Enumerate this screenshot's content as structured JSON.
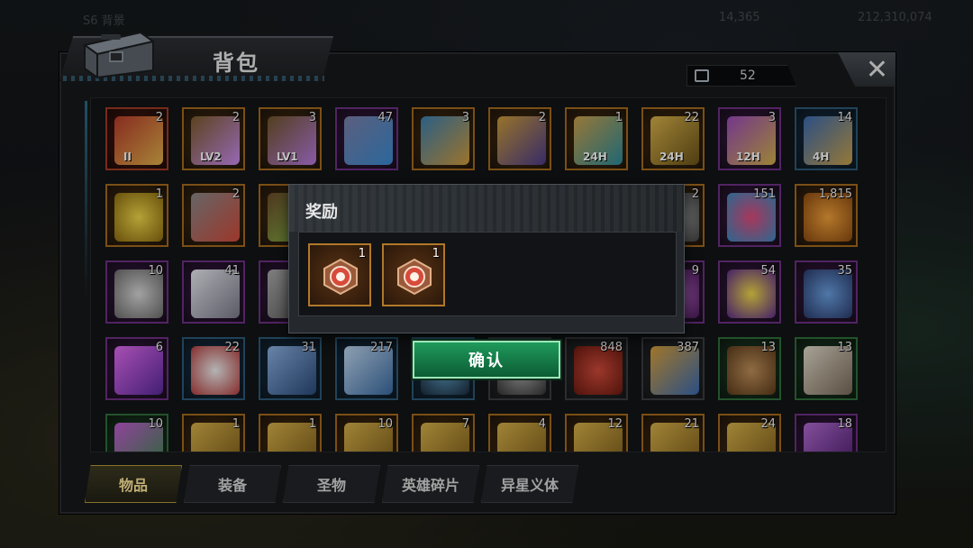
{
  "background_hud": {
    "left_text": "S6 背景",
    "mid_value": "14,365",
    "right_value": "212,310,074"
  },
  "panel": {
    "title": "背包",
    "item_count": "52",
    "close_label": "✕"
  },
  "colors": {
    "orange": "#a56a1c",
    "purple": "#6e2f85",
    "blue": "#2c5877",
    "green": "#2f6e3a",
    "confirm": "#1f9a5c",
    "tab_active": "#b59a3a"
  },
  "grid": {
    "rows": [
      [
        {
          "name": "supply-crate-ii-icon",
          "qty": "2",
          "rarity": "r-red",
          "tag": "II",
          "art": "linear-gradient(135deg,#b53a2a,#e0b04a)"
        },
        {
          "name": "supply-crate-lv2-icon",
          "qty": "2",
          "rarity": "r-orange",
          "tag": "LV2",
          "art": "linear-gradient(135deg,#7a5a28,#c98cf0)"
        },
        {
          "name": "supply-crate-lv1-icon",
          "qty": "3",
          "rarity": "r-orange",
          "tag": "LV1",
          "art": "linear-gradient(135deg,#6e5428,#b67ae0)"
        },
        {
          "name": "gadget-icon",
          "qty": "47",
          "rarity": "r-purple",
          "tag": "",
          "art": "linear-gradient(135deg,#7a7fa8,#3a8ad0)"
        },
        {
          "name": "blue-crate-icon",
          "qty": "3",
          "rarity": "r-orange",
          "tag": "",
          "art": "linear-gradient(135deg,#3a7fb0,#d09a3a)"
        },
        {
          "name": "gold-crate-icon",
          "qty": "2",
          "rarity": "r-orange",
          "tag": "",
          "art": "linear-gradient(135deg,#c99a38,#4a3a8a)"
        },
        {
          "name": "speedup-24h-blue-icon",
          "qty": "1",
          "rarity": "r-orange",
          "tag": "24H",
          "art": "linear-gradient(135deg,#caa04a,#2a8a9a)"
        },
        {
          "name": "speedup-24h-gold-icon",
          "qty": "22",
          "rarity": "r-orange",
          "tag": "24H",
          "art": "linear-gradient(135deg,#d6b04a,#6a5218)"
        },
        {
          "name": "speedup-12h-icon",
          "qty": "3",
          "rarity": "r-purple",
          "tag": "12H",
          "art": "linear-gradient(135deg,#9a4ab8,#d0b04a)"
        },
        {
          "name": "speedup-4h-icon",
          "qty": "14",
          "rarity": "r-blue",
          "tag": "4H",
          "art": "linear-gradient(135deg,#3a6ab0,#c8a04a)"
        }
      ],
      [
        {
          "name": "gold-egg-icon",
          "qty": "1",
          "rarity": "r-orange",
          "tag": "",
          "art": "radial-gradient(circle,#f0d84a,#8a6a10)"
        },
        {
          "name": "syringe-icon",
          "qty": "2",
          "rarity": "r-orange",
          "tag": "",
          "art": "linear-gradient(135deg,#888,#d04a3a)"
        },
        {
          "name": "hidden-item-icon",
          "qty": "",
          "rarity": "r-orange",
          "tag": "",
          "art": "linear-gradient(135deg,#6a4a2a,#8ac04a)"
        },
        {
          "name": "hidden-item-icon",
          "qty": "",
          "rarity": "r-grey",
          "tag": "",
          "art": "none"
        },
        {
          "name": "hidden-item-icon",
          "qty": "",
          "rarity": "r-grey",
          "tag": "",
          "art": "none"
        },
        {
          "name": "hidden-item-icon",
          "qty": "",
          "rarity": "r-grey",
          "tag": "",
          "art": "none"
        },
        {
          "name": "hidden-item-icon",
          "qty": "",
          "rarity": "r-grey",
          "tag": "",
          "art": "none"
        },
        {
          "name": "gear-part-icon",
          "qty": "2",
          "rarity": "r-orange",
          "tag": "",
          "art": "radial-gradient(circle,#aaa,#444)"
        },
        {
          "name": "gem-disc-icon",
          "qty": "151",
          "rarity": "r-purple",
          "tag": "",
          "art": "radial-gradient(circle,#e04a7a,#3a8ac0)"
        },
        {
          "name": "orange-fruit-icon",
          "qty": "1,815",
          "rarity": "r-orange",
          "tag": "",
          "art": "radial-gradient(circle,#f0a03a,#8a4a10)"
        }
      ],
      [
        {
          "name": "silver-coin-icon",
          "qty": "10",
          "rarity": "r-purple",
          "tag": "",
          "art": "radial-gradient(circle,#d8d8d8,#6a6a6a)"
        },
        {
          "name": "crystal-shard-icon",
          "qty": "41",
          "rarity": "r-purple",
          "tag": "",
          "art": "linear-gradient(135deg,#e8e8f0,#7a7a8a)"
        },
        {
          "name": "hidden-item-icon",
          "qty": "",
          "rarity": "r-purple",
          "tag": "",
          "art": "linear-gradient(135deg,#aaa,#555)"
        },
        {
          "name": "hidden-item-icon",
          "qty": "",
          "rarity": "r-grey",
          "tag": "",
          "art": "none"
        },
        {
          "name": "hidden-item-icon",
          "qty": "",
          "rarity": "r-grey",
          "tag": "",
          "art": "none"
        },
        {
          "name": "hidden-item-icon",
          "qty": "",
          "rarity": "r-grey",
          "tag": "",
          "art": "none"
        },
        {
          "name": "hidden-item-icon",
          "qty": "",
          "rarity": "r-grey",
          "tag": "",
          "art": "none"
        },
        {
          "name": "purple-orb-icon",
          "qty": "9",
          "rarity": "r-purple",
          "tag": "",
          "art": "radial-gradient(circle,#c06ad0,#4a1a5a)"
        },
        {
          "name": "poker-chip-icon",
          "qty": "54",
          "rarity": "r-purple",
          "tag": "",
          "art": "radial-gradient(circle,#f0d84a,#5a2a8a)"
        },
        {
          "name": "police-badge-icon",
          "qty": "35",
          "rarity": "r-purple",
          "tag": "",
          "art": "radial-gradient(circle,#6aa0e0,#2a3a6a)"
        }
      ],
      [
        {
          "name": "plasma-sword-icon",
          "qty": "6",
          "rarity": "r-purple",
          "tag": "",
          "art": "linear-gradient(135deg,#e06af0,#5a2a9a)"
        },
        {
          "name": "rabbit-token-icon",
          "qty": "22",
          "rarity": "r-blue",
          "tag": "",
          "art": "radial-gradient(circle,#f0f0f0,#b03a3a)"
        },
        {
          "name": "blue-feather-icon",
          "qty": "31",
          "rarity": "r-blue",
          "tag": "",
          "art": "linear-gradient(135deg,#8ab0e0,#2a4a7a)"
        },
        {
          "name": "cinema-ticket-icon",
          "qty": "217",
          "rarity": "r-blue",
          "tag": "",
          "art": "linear-gradient(135deg,#c0d8f0,#3a6aa0)"
        },
        {
          "name": "hidden-item-icon",
          "qty": "",
          "rarity": "r-blue",
          "tag": "",
          "art": "radial-gradient(circle,#5a9ac0,#1a2a3a)"
        },
        {
          "name": "hidden-item-icon",
          "qty": "",
          "rarity": "r-grey",
          "tag": "",
          "art": "radial-gradient(circle,#aaa,#333)"
        },
        {
          "name": "casino-chip-icon",
          "qty": "848",
          "rarity": "r-grey",
          "tag": "",
          "art": "radial-gradient(circle,#d04a3a,#6a1a10)"
        },
        {
          "name": "bullet-icon",
          "qty": "387",
          "rarity": "r-grey",
          "tag": "",
          "art": "linear-gradient(135deg,#d8a03a,#3a6ab0)"
        },
        {
          "name": "bread-icon",
          "qty": "13",
          "rarity": "r-green",
          "tag": "",
          "art": "radial-gradient(circle,#c0905a,#5a3a1a)"
        },
        {
          "name": "white-feather-icon",
          "qty": "13",
          "rarity": "r-green",
          "tag": "",
          "art": "linear-gradient(135deg,#e0d8c8,#7a6a5a)"
        }
      ],
      [
        {
          "name": "gift-box-icon",
          "qty": "10",
          "rarity": "r-green",
          "tag": "",
          "art": "linear-gradient(135deg,#c05ad0,#3a8a4a)"
        },
        {
          "name": "gold-card-icon",
          "qty": "1",
          "rarity": "r-orange",
          "tag": "",
          "art": "linear-gradient(135deg,#d6b04a,#7a5a18)"
        },
        {
          "name": "gold-card-icon",
          "qty": "1",
          "rarity": "r-orange",
          "tag": "",
          "art": "linear-gradient(135deg,#d6b04a,#7a5a18)"
        },
        {
          "name": "gold-card-icon",
          "qty": "10",
          "rarity": "r-orange",
          "tag": "",
          "art": "linear-gradient(135deg,#d6b04a,#7a5a18)"
        },
        {
          "name": "gold-card-icon",
          "qty": "7",
          "rarity": "r-orange",
          "tag": "",
          "art": "linear-gradient(135deg,#d6b04a,#7a5a18)"
        },
        {
          "name": "gold-card-icon",
          "qty": "4",
          "rarity": "r-orange",
          "tag": "",
          "art": "linear-gradient(135deg,#d6b04a,#7a5a18)"
        },
        {
          "name": "gold-card-icon",
          "qty": "12",
          "rarity": "r-orange",
          "tag": "",
          "art": "linear-gradient(135deg,#d6b04a,#7a5a18)"
        },
        {
          "name": "gold-card-icon",
          "qty": "21",
          "rarity": "r-orange",
          "tag": "",
          "art": "linear-gradient(135deg,#d6b04a,#7a5a18)"
        },
        {
          "name": "gold-card-icon",
          "qty": "24",
          "rarity": "r-orange",
          "tag": "",
          "art": "linear-gradient(135deg,#d6b04a,#7a5a18)"
        },
        {
          "name": "purple-card-icon",
          "qty": "18",
          "rarity": "r-purple",
          "tag": "",
          "art": "linear-gradient(135deg,#b06ad0,#4a1a6a)"
        }
      ]
    ]
  },
  "tabs": [
    {
      "label": "物品",
      "active": true
    },
    {
      "label": "装备",
      "active": false
    },
    {
      "label": "圣物",
      "active": false
    },
    {
      "label": "英雄碎片",
      "active": false
    },
    {
      "label": "异星义体",
      "active": false
    }
  ],
  "reward_dialog": {
    "title": "奖励",
    "items": [
      {
        "name": "reward-token-icon",
        "qty": "1"
      },
      {
        "name": "reward-token-icon",
        "qty": "1"
      }
    ],
    "confirm_label": "确认"
  }
}
